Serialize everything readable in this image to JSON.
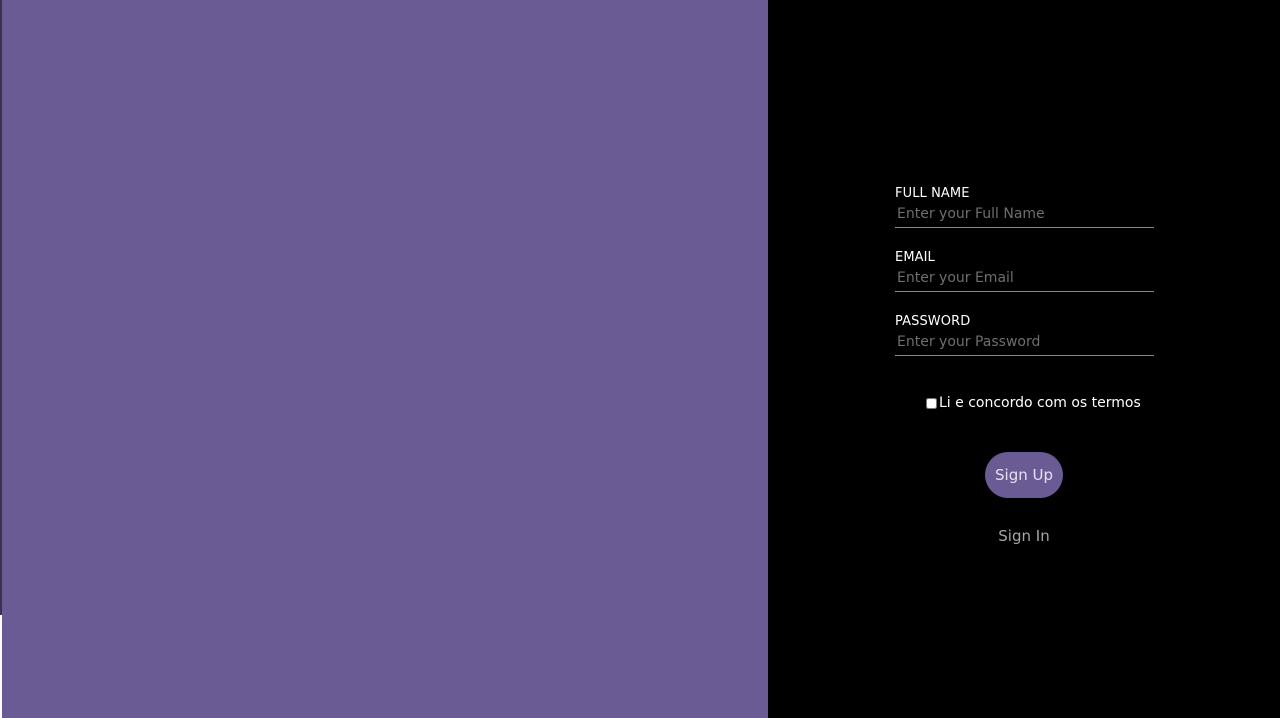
{
  "colors": {
    "accent": "#6b5b95",
    "background": "#000000",
    "label_text": "#ffffff",
    "placeholder_text": "#6e6e6e",
    "link_text": "#a6a6a6"
  },
  "form": {
    "full_name": {
      "label": "FULL NAME",
      "placeholder": "Enter your Full Name",
      "value": ""
    },
    "email": {
      "label": "EMAIL",
      "placeholder": "Enter your Email",
      "value": ""
    },
    "password": {
      "label": "PASSWORD",
      "placeholder": "Enter your Password",
      "value": ""
    },
    "terms": {
      "label": "Li e concordo com os termos",
      "checked": false
    },
    "signup_label": "Sign Up",
    "signin_label": "Sign In"
  }
}
